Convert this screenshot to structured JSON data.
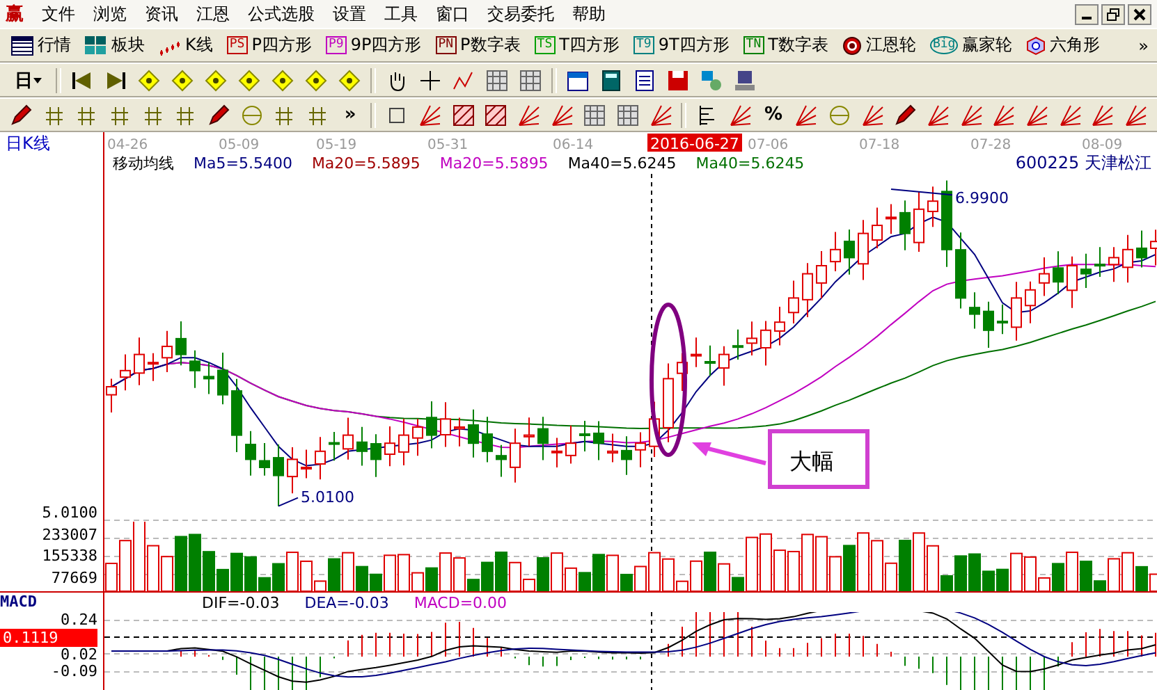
{
  "app_icon": "赢",
  "menu": [
    "文件",
    "浏览",
    "资讯",
    "江恩",
    "公式选股",
    "设置",
    "工具",
    "窗口",
    "交易委托",
    "帮助"
  ],
  "toolbar": [
    {
      "kind": "grid",
      "label": "行情"
    },
    {
      "kind": "blocks",
      "label": "板块"
    },
    {
      "kind": "candles",
      "label": "K线"
    },
    {
      "kind": "badge",
      "badge": "PS",
      "color": "#c00000",
      "label": "P四方形"
    },
    {
      "kind": "badge",
      "badge": "P9",
      "color": "#c000c0",
      "label": "9P四方形"
    },
    {
      "kind": "badge",
      "badge": "PN",
      "color": "#800000",
      "label": "P数字表"
    },
    {
      "kind": "badge",
      "badge": "TS",
      "color": "#00a000",
      "label": "T四方形"
    },
    {
      "kind": "badge",
      "badge": "T9",
      "color": "#008080",
      "label": "9T四方形"
    },
    {
      "kind": "badge",
      "badge": "TN",
      "color": "#008000",
      "label": "T数字表"
    },
    {
      "kind": "ring",
      "label": "江恩轮"
    },
    {
      "kind": "circle",
      "badge": "Big",
      "label": "赢家轮"
    },
    {
      "kind": "hexagon",
      "label": "六角形"
    }
  ],
  "toolbar_more": "»",
  "period_selector": "日",
  "percent_tool": "%",
  "draw_toolbar_more": "»",
  "chart": {
    "title": "日K线",
    "dates": [
      {
        "label": "04-26",
        "selected": false
      },
      {
        "label": "05-09",
        "selected": false
      },
      {
        "label": "05-19",
        "selected": false
      },
      {
        "label": "05-31",
        "selected": false
      },
      {
        "label": "06-14",
        "selected": false
      },
      {
        "label": "2016-06-27",
        "selected": true
      },
      {
        "label": "07-06",
        "selected": false
      },
      {
        "label": "07-18",
        "selected": false
      },
      {
        "label": "07-28",
        "selected": false
      },
      {
        "label": "08-09",
        "selected": false
      }
    ],
    "indicator": "移动均线",
    "legend": [
      {
        "text": "Ma5=5.5400",
        "color": "#000080"
      },
      {
        "text": "Ma20=5.5895",
        "color": "#a00000"
      },
      {
        "text": "Ma20=5.5895",
        "color": "#c000c0"
      },
      {
        "text": "Ma40=5.6245",
        "color": "#000000"
      },
      {
        "text": "Ma40=5.6245",
        "color": "#007000"
      }
    ],
    "stock": "600225 天津松江",
    "high_label": "6.9900",
    "low_label": "5.0100",
    "axis_low": "5.0100",
    "callout": "大幅",
    "volume_ticks": [
      "233007",
      "155338",
      "77669"
    ],
    "macd": {
      "title": "MACD",
      "dif": "DIF=-0.03",
      "dea": "DEA=-0.03",
      "value": "MACD=0.00",
      "ticks": [
        "0.24",
        "0.02",
        "-0.09"
      ],
      "current": "0.1119"
    }
  }
}
